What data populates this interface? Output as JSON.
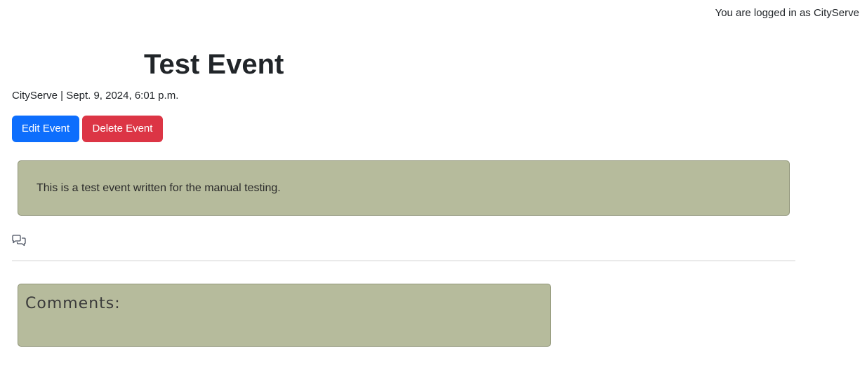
{
  "header": {
    "login_status": "You are logged in as CityServe"
  },
  "event": {
    "title": "Test Event",
    "byline": "CityServe | Sept. 9, 2024, 6:01 p.m.",
    "content": "This is a test event written for the manual testing."
  },
  "actions": {
    "edit_label": "Edit Event",
    "delete_label": "Delete Event"
  },
  "comments": {
    "icon": "comments-icon",
    "heading": "Comments:"
  },
  "colors": {
    "edit_button": "#0d6efd",
    "delete_button": "#dc3545",
    "card_background": "#b6bb9c"
  }
}
